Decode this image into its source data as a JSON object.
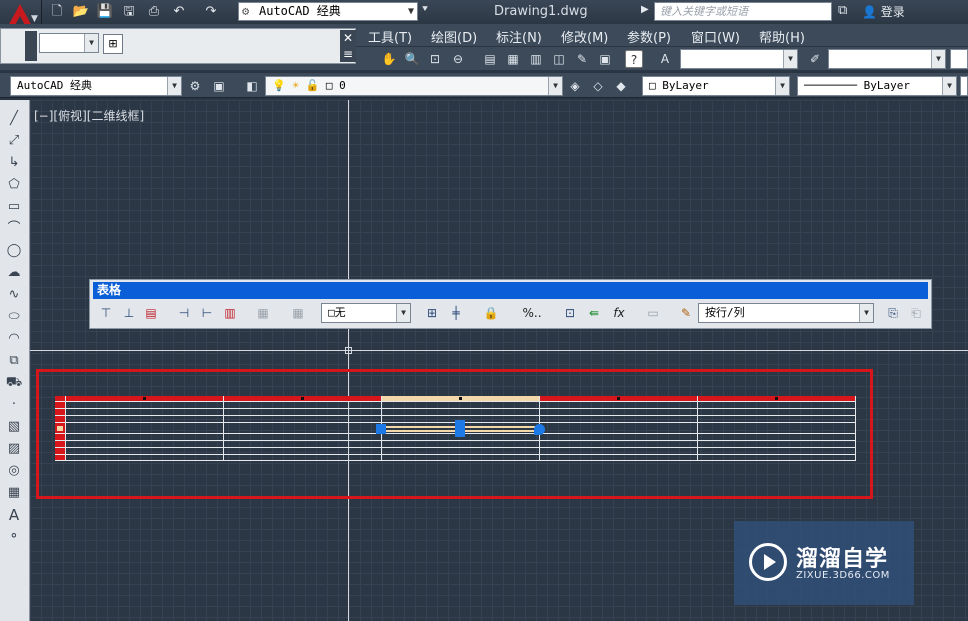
{
  "app": {
    "workspace": "AutoCAD 经典",
    "doc_title": "Drawing1.dwg",
    "search_placeholder": "键入关键字或短语",
    "login": "登录"
  },
  "menubar": [
    "工具(T)",
    "绘图(D)",
    "标注(N)",
    "修改(M)",
    "参数(P)",
    "窗口(W)",
    "帮助(H)"
  ],
  "toolbar": {
    "workspace_combo": "AutoCAD 经典",
    "layer_combo": "0",
    "color_combo": "ByLayer",
    "linetype_combo": "ByLayer"
  },
  "viewport": {
    "label": "[−][俯视][二维线框]"
  },
  "table_toolbar": {
    "title": "表格",
    "border_combo": "无",
    "mode_combo": "按行/列",
    "percent_label": "%.."
  },
  "watermark": {
    "name": "溜溜自学",
    "url": "ZIXUE.3D66.COM"
  },
  "colors": {
    "accent_red": "#d6161b",
    "selection_blue": "#1d79e6",
    "header_blue": "#0a5fd8"
  }
}
